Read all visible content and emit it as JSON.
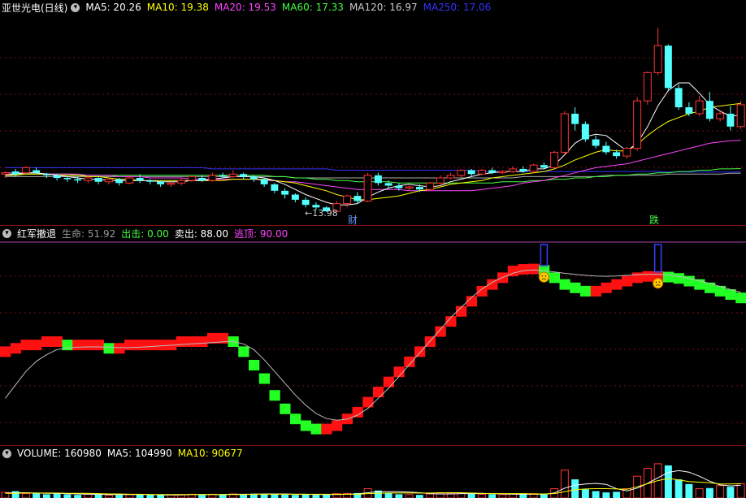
{
  "main": {
    "title": "亚世光电(日线)",
    "ma": [
      {
        "label": "MA5: 20.26",
        "color": "#ffffff"
      },
      {
        "label": "MA10: 19.38",
        "color": "#ffff00"
      },
      {
        "label": "MA20: 19.53",
        "color": "#ff44ff"
      },
      {
        "label": "MA60: 17.33",
        "color": "#44ff44"
      },
      {
        "label": "MA120: 16.97",
        "color": "#cccccc"
      },
      {
        "label": "MA250: 17.06",
        "color": "#3333ff"
      }
    ],
    "low_label": "←13.98",
    "tag_cai": "财",
    "tag_die": "跌"
  },
  "mid": {
    "title": "红军撤退",
    "items": [
      {
        "label": "生命: 51.92",
        "color": "#999999"
      },
      {
        "label": "出击: 0.00",
        "color": "#44ff44"
      },
      {
        "label": "卖出: 88.00",
        "color": "#ffffff"
      },
      {
        "label": "逃顶: 90.00",
        "color": "#ff44ff"
      }
    ]
  },
  "vol": {
    "items": [
      {
        "label": "VOLUME: 160980",
        "color": "#ffffff"
      },
      {
        "label": "MA5: 104990",
        "color": "#ffffff"
      },
      {
        "label": "MA10: 90677",
        "color": "#ffff00"
      }
    ]
  },
  "chart_data": {
    "type": "candlestick",
    "candles": [
      [
        16.9,
        17.0,
        16.6,
        17.1
      ],
      [
        17.1,
        16.9,
        16.7,
        17.3
      ],
      [
        17.0,
        17.4,
        16.8,
        17.5
      ],
      [
        17.2,
        17.0,
        16.9,
        17.4
      ],
      [
        16.9,
        16.8,
        16.6,
        17.0
      ],
      [
        16.8,
        16.6,
        16.4,
        16.9
      ],
      [
        16.6,
        16.5,
        16.3,
        16.7
      ],
      [
        16.5,
        16.4,
        16.2,
        16.7
      ],
      [
        16.4,
        16.6,
        16.2,
        16.8
      ],
      [
        16.6,
        16.3,
        16.1,
        16.7
      ],
      [
        16.3,
        16.5,
        16.1,
        16.6
      ],
      [
        16.5,
        16.2,
        16.0,
        16.6
      ],
      [
        16.2,
        16.6,
        16.1,
        16.8
      ],
      [
        16.6,
        16.4,
        16.2,
        16.9
      ],
      [
        16.4,
        16.3,
        16.1,
        16.5
      ],
      [
        16.3,
        16.1,
        15.9,
        16.4
      ],
      [
        16.1,
        16.2,
        15.9,
        16.3
      ],
      [
        16.2,
        16.4,
        16.0,
        16.6
      ],
      [
        16.4,
        16.7,
        16.3,
        16.8
      ],
      [
        16.6,
        16.4,
        16.3,
        16.8
      ],
      [
        16.4,
        16.8,
        16.3,
        17.0
      ],
      [
        16.8,
        16.7,
        16.6,
        17.0
      ],
      [
        16.7,
        16.9,
        16.6,
        17.2
      ],
      [
        16.9,
        16.7,
        16.5,
        17.0
      ],
      [
        16.7,
        16.5,
        16.3,
        16.8
      ],
      [
        16.5,
        16.1,
        15.9,
        16.6
      ],
      [
        16.1,
        15.6,
        15.4,
        16.2
      ],
      [
        15.6,
        15.3,
        15.0,
        15.8
      ],
      [
        15.3,
        14.9,
        14.7,
        15.4
      ],
      [
        14.9,
        14.5,
        14.3,
        15.1
      ],
      [
        14.5,
        14.3,
        14.1,
        14.7
      ],
      [
        14.3,
        14.0,
        13.98,
        14.4
      ],
      [
        14.0,
        14.6,
        13.98,
        14.8
      ],
      [
        14.6,
        15.2,
        14.3,
        15.3
      ],
      [
        15.2,
        14.8,
        14.6,
        15.5
      ],
      [
        14.8,
        16.8,
        14.7,
        17.0
      ],
      [
        16.8,
        16.2,
        16.0,
        17.0
      ],
      [
        16.2,
        16.0,
        15.8,
        16.4
      ],
      [
        16.0,
        15.8,
        15.6,
        16.2
      ],
      [
        15.8,
        15.9,
        15.6,
        16.0
      ],
      [
        15.9,
        15.7,
        15.5,
        16.1
      ],
      [
        15.7,
        16.2,
        15.6,
        16.3
      ],
      [
        16.2,
        16.6,
        16.0,
        16.8
      ],
      [
        16.6,
        16.8,
        16.5,
        17.0
      ],
      [
        16.8,
        17.2,
        16.6,
        17.3
      ],
      [
        17.2,
        16.9,
        16.7,
        17.3
      ],
      [
        16.9,
        17.2,
        16.8,
        17.3
      ],
      [
        17.2,
        17.0,
        16.9,
        17.4
      ],
      [
        17.0,
        17.1,
        16.9,
        17.2
      ],
      [
        17.1,
        17.3,
        17.0,
        17.5
      ],
      [
        17.3,
        17.1,
        17.0,
        17.5
      ],
      [
        17.1,
        17.6,
        17.0,
        17.7
      ],
      [
        17.6,
        17.4,
        17.3,
        17.8
      ],
      [
        17.4,
        18.6,
        17.3,
        18.7
      ],
      [
        18.6,
        21.6,
        18.4,
        21.8
      ],
      [
        21.6,
        20.8,
        20.3,
        22.1
      ],
      [
        20.8,
        19.6,
        19.4,
        21.0
      ],
      [
        19.6,
        19.1,
        18.9,
        19.9
      ],
      [
        19.1,
        18.6,
        18.4,
        19.4
      ],
      [
        18.6,
        18.3,
        18.1,
        18.8
      ],
      [
        18.3,
        18.9,
        18.1,
        19.0
      ],
      [
        18.9,
        22.6,
        18.7,
        22.9
      ],
      [
        22.6,
        24.8,
        22.3,
        24.9
      ],
      [
        24.8,
        26.9,
        24.6,
        28.3
      ],
      [
        26.9,
        23.6,
        23.4,
        27.0
      ],
      [
        23.6,
        22.1,
        21.9,
        23.9
      ],
      [
        22.1,
        21.6,
        21.4,
        22.5
      ],
      [
        21.6,
        22.6,
        21.4,
        23.0
      ],
      [
        22.6,
        21.2,
        21.0,
        23.3
      ],
      [
        21.2,
        21.6,
        21.0,
        21.9
      ],
      [
        21.6,
        20.6,
        20.3,
        22.2
      ],
      [
        20.6,
        22.3,
        20.4,
        22.6
      ]
    ],
    "ma5": [
      16.8,
      16.9,
      17.0,
      17.0,
      16.9,
      16.8,
      16.7,
      16.6,
      16.5,
      16.5,
      16.4,
      16.4,
      16.4,
      16.4,
      16.4,
      16.3,
      16.3,
      16.3,
      16.4,
      16.4,
      16.5,
      16.6,
      16.7,
      16.7,
      16.7,
      16.6,
      16.4,
      16.1,
      15.7,
      15.3,
      15.0,
      14.7,
      14.5,
      14.5,
      14.6,
      15.1,
      15.5,
      15.8,
      16.0,
      16.1,
      16.0,
      15.9,
      16.0,
      16.3,
      16.5,
      16.7,
      16.9,
      17.0,
      17.1,
      17.1,
      17.1,
      17.3,
      17.3,
      17.6,
      18.4,
      19.3,
      19.8,
      20.0,
      19.9,
      19.3,
      18.7,
      19.3,
      20.6,
      22.2,
      23.4,
      24.0,
      24.0,
      23.2,
      22.3,
      21.8,
      21.4,
      21.5
    ],
    "ma10": [
      16.8,
      16.8,
      16.9,
      16.9,
      16.9,
      16.8,
      16.8,
      16.8,
      16.7,
      16.7,
      16.6,
      16.5,
      16.5,
      16.4,
      16.4,
      16.4,
      16.4,
      16.4,
      16.4,
      16.4,
      16.4,
      16.4,
      16.5,
      16.5,
      16.5,
      16.5,
      16.4,
      16.3,
      16.2,
      16.0,
      15.8,
      15.6,
      15.3,
      15.1,
      14.9,
      14.9,
      15.0,
      15.1,
      15.2,
      15.4,
      15.6,
      15.7,
      15.9,
      16.1,
      16.2,
      16.3,
      16.4,
      16.6,
      16.7,
      16.8,
      16.9,
      17.0,
      17.1,
      17.3,
      17.6,
      18.0,
      18.3,
      18.6,
      18.8,
      18.7,
      18.7,
      19.2,
      19.9,
      20.5,
      21.0,
      21.3,
      21.6,
      21.8,
      22.1,
      22.2,
      22.3,
      22.4
    ],
    "ma20": [
      17.0,
      17.0,
      17.0,
      17.0,
      16.9,
      16.9,
      16.9,
      16.9,
      16.8,
      16.8,
      16.8,
      16.7,
      16.7,
      16.7,
      16.6,
      16.6,
      16.6,
      16.6,
      16.5,
      16.5,
      16.5,
      16.5,
      16.5,
      16.5,
      16.5,
      16.4,
      16.4,
      16.3,
      16.3,
      16.2,
      16.1,
      16.0,
      15.9,
      15.8,
      15.7,
      15.7,
      15.7,
      15.7,
      15.7,
      15.6,
      15.6,
      15.6,
      15.6,
      15.6,
      15.6,
      15.6,
      15.7,
      15.8,
      15.9,
      16.0,
      16.2,
      16.3,
      16.4,
      16.6,
      16.8,
      17.0,
      17.2,
      17.4,
      17.5,
      17.6,
      17.7,
      17.9,
      18.1,
      18.3,
      18.5,
      18.7,
      18.9,
      19.1,
      19.3,
      19.4,
      19.5,
      19.53
    ],
    "ma60": [
      16.9,
      16.9,
      16.9,
      16.9,
      16.9,
      16.9,
      16.9,
      16.8,
      16.8,
      16.8,
      16.8,
      16.8,
      16.8,
      16.8,
      16.8,
      16.8,
      16.8,
      16.8,
      16.8,
      16.8,
      16.8,
      16.8,
      16.8,
      16.8,
      16.8,
      16.8,
      16.7,
      16.7,
      16.6,
      16.6,
      16.5,
      16.5,
      16.4,
      16.4,
      16.3,
      16.3,
      16.3,
      16.3,
      16.2,
      16.2,
      16.2,
      16.2,
      16.2,
      16.2,
      16.2,
      16.2,
      16.2,
      16.2,
      16.3,
      16.3,
      16.3,
      16.4,
      16.4,
      16.5,
      16.5,
      16.6,
      16.6,
      16.7,
      16.7,
      16.8,
      16.8,
      16.9,
      16.9,
      17.0,
      17.0,
      17.1,
      17.1,
      17.2,
      17.2,
      17.3,
      17.3,
      17.33
    ],
    "ma120": [
      16.7,
      16.7,
      16.7,
      16.7,
      16.7,
      16.7,
      16.7,
      16.7,
      16.7,
      16.7,
      16.7,
      16.7,
      16.7,
      16.7,
      16.7,
      16.7,
      16.7,
      16.7,
      16.7,
      16.7,
      16.7,
      16.7,
      16.7,
      16.7,
      16.7,
      16.7,
      16.7,
      16.7,
      16.6,
      16.6,
      16.6,
      16.6,
      16.6,
      16.6,
      16.6,
      16.6,
      16.6,
      16.6,
      16.6,
      16.6,
      16.6,
      16.6,
      16.6,
      16.6,
      16.6,
      16.6,
      16.6,
      16.6,
      16.6,
      16.6,
      16.7,
      16.7,
      16.7,
      16.7,
      16.7,
      16.7,
      16.7,
      16.7,
      16.8,
      16.8,
      16.8,
      16.8,
      16.8,
      16.8,
      16.9,
      16.9,
      16.9,
      16.9,
      16.9,
      16.9,
      16.97,
      16.97
    ],
    "ma250": [
      17.4,
      17.4,
      17.4,
      17.4,
      17.4,
      17.4,
      17.4,
      17.4,
      17.4,
      17.4,
      17.4,
      17.4,
      17.4,
      17.4,
      17.4,
      17.4,
      17.4,
      17.4,
      17.4,
      17.4,
      17.3,
      17.3,
      17.3,
      17.3,
      17.3,
      17.3,
      17.3,
      17.3,
      17.3,
      17.3,
      17.3,
      17.3,
      17.2,
      17.2,
      17.2,
      17.2,
      17.2,
      17.2,
      17.2,
      17.2,
      17.2,
      17.2,
      17.2,
      17.2,
      17.2,
      17.2,
      17.1,
      17.1,
      17.1,
      17.1,
      17.1,
      17.1,
      17.1,
      17.1,
      17.1,
      17.1,
      17.1,
      17.1,
      17.1,
      17.1,
      17.1,
      17.1,
      17.1,
      17.1,
      17.06,
      17.06,
      17.06,
      17.06,
      17.06,
      17.06,
      17.06,
      17.06
    ],
    "indicator": {
      "life": [
        64,
        65,
        66,
        66,
        67,
        67,
        66,
        66,
        66,
        66,
        65,
        65,
        66,
        66,
        66,
        66,
        66,
        67,
        67,
        67,
        68,
        68,
        67,
        64,
        60,
        56,
        51,
        47,
        44,
        42,
        41,
        41,
        42,
        44,
        46,
        49,
        52,
        55,
        58,
        61,
        64,
        67,
        70,
        73,
        76,
        79,
        82,
        84,
        86,
        88,
        88.5,
        88.6,
        88.2,
        86,
        84,
        83,
        82,
        82,
        83,
        84,
        85,
        86,
        86.4,
        86.4,
        86.2,
        85.8,
        85,
        84,
        83,
        82,
        81,
        80
      ],
      "line": [
        50,
        54,
        58,
        61,
        63,
        64.5,
        65,
        65.2,
        65.3,
        65.3,
        65.2,
        65.1,
        65.1,
        65.2,
        65.4,
        65.6,
        65.8,
        66,
        66.2,
        66.4,
        66.6,
        66.8,
        66.9,
        66.2,
        64.5,
        61.5,
        58,
        54.5,
        51,
        48,
        45.5,
        44,
        43.5,
        43.8,
        45,
        47,
        50,
        53,
        56.5,
        60,
        63.5,
        67,
        70.5,
        74,
        77,
        80,
        82.5,
        84.5,
        86,
        87.2,
        88,
        88.2,
        88,
        87.6,
        87.2,
        86.9,
        86.6,
        86.4,
        86.3,
        86.4,
        86.6,
        86.8,
        86.9,
        86.9,
        86.7,
        86.3,
        85.7,
        85,
        84.2,
        83.3,
        82.4,
        81.5
      ],
      "escape_signals": [
        52,
        63
      ]
    },
    "volume": [
      18,
      22,
      14,
      16,
      12,
      15,
      12,
      10,
      13,
      11,
      9,
      10,
      11,
      12,
      10,
      9,
      10,
      11,
      12,
      10,
      12,
      11,
      13,
      12,
      14,
      13,
      12,
      11,
      10,
      12,
      10,
      11,
      14,
      15,
      16,
      30,
      24,
      16,
      12,
      11,
      10,
      13,
      14,
      15,
      16,
      13,
      12,
      12,
      11,
      13,
      12,
      14,
      13,
      30,
      90,
      60,
      28,
      22,
      18,
      20,
      30,
      70,
      95,
      110,
      105,
      60,
      45,
      30,
      32,
      40,
      36,
      46
    ],
    "vol_ma5": [
      16,
      17,
      17,
      16,
      15,
      15,
      14,
      13,
      12,
      12,
      11,
      11,
      11,
      11,
      11,
      10,
      10,
      10,
      11,
      11,
      11,
      11,
      12,
      12,
      12,
      13,
      13,
      13,
      12,
      12,
      11,
      11,
      11,
      12,
      13,
      17,
      20,
      20,
      20,
      19,
      17,
      14,
      13,
      13,
      14,
      14,
      14,
      14,
      13,
      12,
      12,
      12,
      12,
      16,
      32,
      41,
      45,
      47,
      44,
      30,
      23,
      32,
      47,
      65,
      82,
      88,
      83,
      70,
      54,
      42,
      39,
      41
    ],
    "vol_ma10": [
      15,
      15,
      16,
      16,
      16,
      16,
      15,
      15,
      15,
      14,
      13,
      13,
      12,
      12,
      11,
      11,
      11,
      11,
      11,
      11,
      11,
      11,
      11,
      11,
      12,
      12,
      12,
      12,
      12,
      12,
      12,
      12,
      12,
      12,
      12,
      14,
      15,
      16,
      16,
      16,
      16,
      16,
      17,
      17,
      17,
      16,
      15,
      14,
      14,
      14,
      14,
      13,
      13,
      14,
      20,
      27,
      29,
      30,
      30,
      29,
      28,
      36,
      46,
      56,
      63,
      58,
      53,
      51,
      49,
      45,
      45,
      46
    ]
  }
}
